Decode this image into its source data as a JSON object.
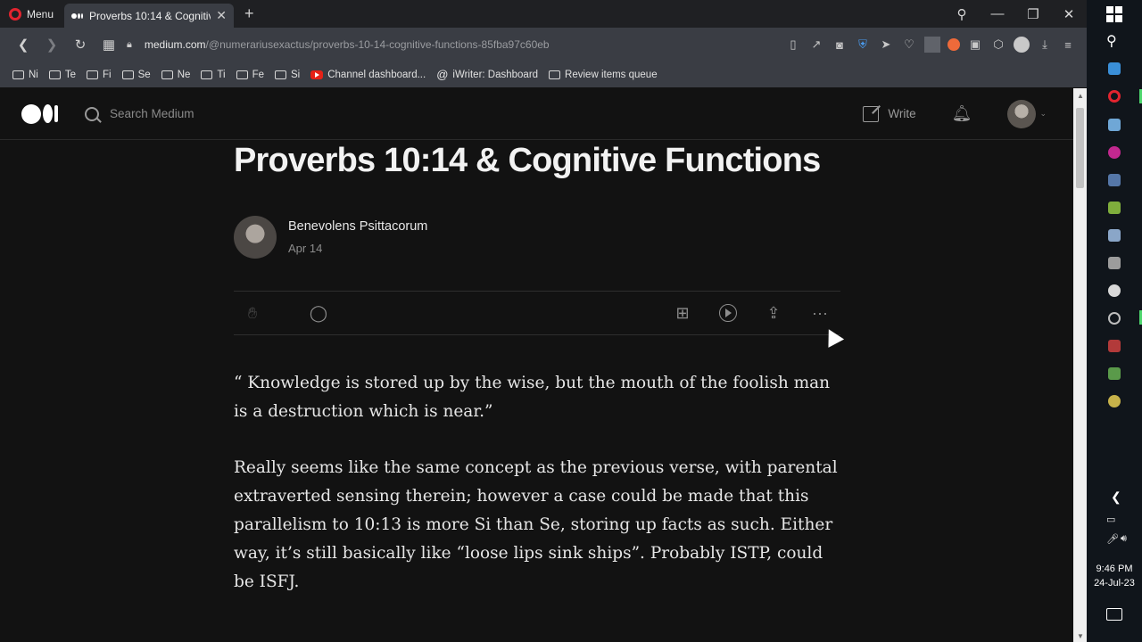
{
  "browser": {
    "menu_label": "Menu",
    "tab_title": "Proverbs 10:14 & Cognitive",
    "url_host": "medium.com",
    "url_path": "/@numerariusexactus/proverbs-10-14-cognitive-functions-85fba97c60eb",
    "bookmarks": [
      {
        "icon": "folder-icon",
        "label": "Ni"
      },
      {
        "icon": "folder-icon",
        "label": "Te"
      },
      {
        "icon": "folder-icon",
        "label": "Fi"
      },
      {
        "icon": "folder-icon",
        "label": "Se"
      },
      {
        "icon": "folder-icon",
        "label": "Ne"
      },
      {
        "icon": "folder-icon",
        "label": "Ti"
      },
      {
        "icon": "folder-icon",
        "label": "Fe"
      },
      {
        "icon": "folder-icon",
        "label": "Si"
      },
      {
        "icon": "youtube-icon",
        "label": "Channel dashboard..."
      },
      {
        "icon": "at-icon",
        "label": "iWriter: Dashboard"
      },
      {
        "icon": "folder-icon",
        "label": "Review items queue"
      }
    ]
  },
  "medium": {
    "search_placeholder": "Search Medium",
    "write_label": "Write"
  },
  "article": {
    "title": "Proverbs 10:14 & Cognitive Functions",
    "author": "Benevolens Psittacorum",
    "date": "Apr 14",
    "paragraphs": [
      "“ Knowledge is stored up by the wise, but the mouth of the foolish man is a destruction which is near.”",
      "Really seems like the same concept as the previous verse, with parental extraverted sensing therein; however a case could be made that this parallelism to 10:13 is more Si than Se, storing up facts as such. Either way, it’s still basically like “loose lips sink ships”. Probably ISTP, could be ISFJ."
    ]
  },
  "taskbar": {
    "time": "9:46 PM",
    "date": "24-Jul-23"
  },
  "colors": {
    "page_bg": "#121212",
    "tab_bg": "#3a3d44",
    "opera_red": "#e2242f",
    "active_indicator": "#4dd66d"
  }
}
